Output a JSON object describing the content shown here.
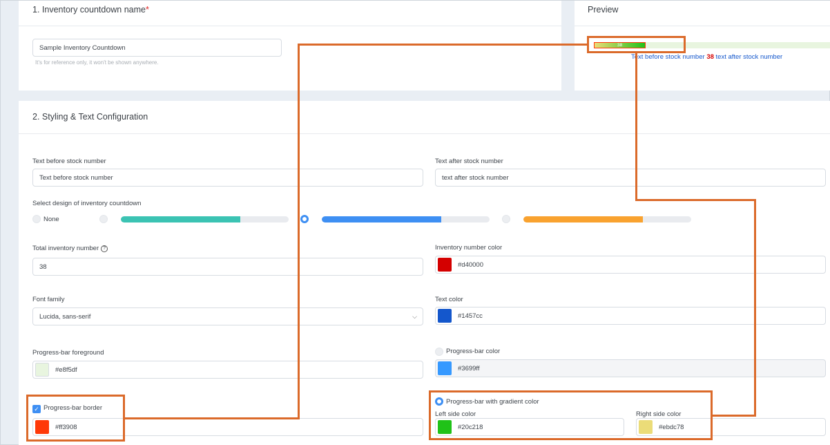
{
  "section1": {
    "title": "1. Inventory countdown name",
    "required_mark": "*",
    "name_value": "Sample Inventory Countdown",
    "hint": "It's for reference only, it won't be shown anywhere."
  },
  "preview": {
    "title": "Preview",
    "bar_number": "38",
    "text_before": "Text before stock number",
    "number": "38",
    "text_after": "text after stock number",
    "bar_fill_fraction": 0.22
  },
  "section2": {
    "title": "2. Styling & Text Configuration",
    "text_before_label": "Text before stock number",
    "text_before_value": "Text before stock number",
    "text_after_label": "Text after stock number",
    "text_after_value": "text after stock number",
    "design_label": "Select design of inventory countdown",
    "design_none_label": "None",
    "designs": [
      {
        "color": "#3bc3b3",
        "fill_fraction": 0.71,
        "selected": false
      },
      {
        "color": "#3e8ff3",
        "fill_fraction": 0.71,
        "selected": true
      },
      {
        "color": "#f9a22f",
        "fill_fraction": 0.71,
        "selected": false
      }
    ],
    "total_label": "Total inventory number",
    "total_value": "38",
    "inv_color_label": "Inventory number color",
    "inv_color_value": "#d40000",
    "font_label": "Font family",
    "font_value": "Lucida, sans-serif",
    "text_color_label": "Text color",
    "text_color_value": "#1457cc",
    "fg_label": "Progress-bar foreground",
    "fg_value": "#e8f5df",
    "pb_color_label": "Progress-bar color",
    "pb_color_value": "#3699ff",
    "border_label": "Progress-bar border",
    "border_value": "#ff3908",
    "gradient_label": "Progress-bar with gradient color",
    "left_label": "Left side color",
    "left_value": "#20c218",
    "right_label": "Right side color",
    "right_value": "#ebdc78"
  },
  "colors": {
    "accent": "#3e8ff3",
    "annotation": "#db6a2a",
    "inv_number": "#d40000",
    "text": "#1457cc",
    "foreground": "#e8f5df",
    "pb_color": "#3699ff",
    "border": "#ff3908",
    "left": "#20c218",
    "right": "#ebdc78"
  }
}
